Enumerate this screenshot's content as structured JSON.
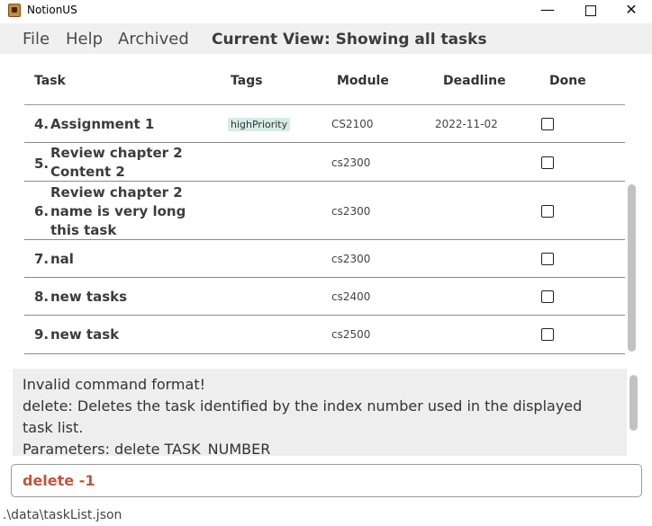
{
  "window": {
    "title": "NotionUS",
    "minimize_glyph": "—",
    "close_glyph": "✕"
  },
  "menu": {
    "file": "File",
    "help": "Help",
    "archived": "Archived"
  },
  "current_view": "Current View: Showing all tasks",
  "table": {
    "headers": {
      "task": "Task",
      "tags": "Tags",
      "module": "Module",
      "deadline": "Deadline",
      "done": "Done"
    },
    "rows": [
      {
        "index": "4.",
        "name": "Assignment 1",
        "tag": "highPriority",
        "module": "CS2100",
        "deadline": "2022-11-02",
        "done": false
      },
      {
        "index": "5.",
        "name": "Review chapter 2 Content 2",
        "tag": "",
        "module": "cs2300",
        "deadline": "",
        "done": false
      },
      {
        "index": "6.",
        "name": "Review chapter 2 name is very long this task",
        "tag": "",
        "module": "cs2300",
        "deadline": "",
        "done": false
      },
      {
        "index": "7.",
        "name": "nal",
        "tag": "",
        "module": "cs2300",
        "deadline": "",
        "done": false
      },
      {
        "index": "8.",
        "name": "new tasks",
        "tag": "",
        "module": "cs2400",
        "deadline": "",
        "done": false
      },
      {
        "index": "9.",
        "name": "new task",
        "tag": "",
        "module": "cs2500",
        "deadline": "",
        "done": false
      }
    ]
  },
  "result": "Invalid command format!\ndelete: Deletes the task identified by the index number used in the displayed task list.\nParameters: delete TASK_NUMBER",
  "command": {
    "value": "delete -1"
  },
  "status": {
    "path": ".\\data\\taskList.json"
  }
}
